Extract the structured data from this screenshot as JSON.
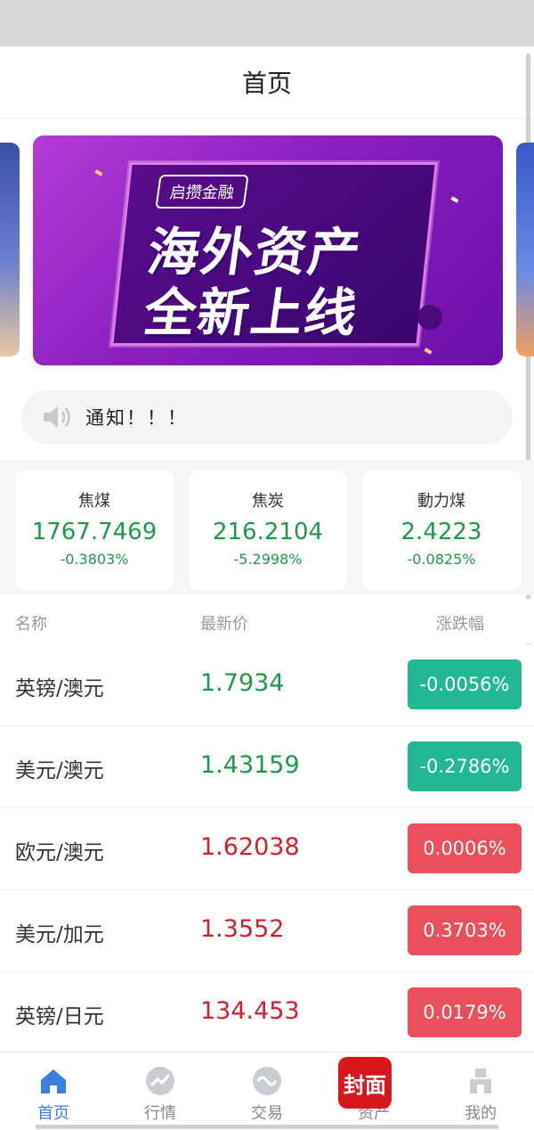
{
  "header": {
    "title": "首页"
  },
  "banner": {
    "brand": "启攒金融",
    "line1": "海外资产",
    "line2": "全新上线"
  },
  "notice": {
    "text": "通知！！！"
  },
  "cards": [
    {
      "name": "焦煤",
      "price": "1767.7469",
      "change": "-0.3803%"
    },
    {
      "name": "焦炭",
      "price": "216.2104",
      "change": "-5.2998%"
    },
    {
      "name": "動力煤",
      "price": "2.4223",
      "change": "-0.0825%"
    }
  ],
  "list": {
    "headers": {
      "name": "名称",
      "price": "最新价",
      "change": "涨跌幅"
    },
    "rows": [
      {
        "pair": "英镑/澳元",
        "price": "1.7934",
        "change": "-0.0056%",
        "direction": "down"
      },
      {
        "pair": "美元/澳元",
        "price": "1.43159",
        "change": "-0.2786%",
        "direction": "down"
      },
      {
        "pair": "欧元/澳元",
        "price": "1.62038",
        "change": "0.0006%",
        "direction": "up"
      },
      {
        "pair": "美元/加元",
        "price": "1.3552",
        "change": "0.3703%",
        "direction": "up"
      },
      {
        "pair": "英镑/日元",
        "price": "134.453",
        "change": "0.0179%",
        "direction": "up"
      }
    ]
  },
  "tabs": [
    {
      "label": "首页",
      "icon": "home-icon",
      "active": true
    },
    {
      "label": "行情",
      "icon": "chart-icon",
      "active": false
    },
    {
      "label": "交易",
      "icon": "exchange-icon",
      "active": false
    },
    {
      "label": "资产",
      "icon": "wallet-icon",
      "active": false
    },
    {
      "label": "我的",
      "icon": "profile-icon",
      "active": false
    }
  ],
  "watermark": {
    "text": "封面"
  },
  "colors": {
    "up": "#d0202e",
    "down": "#1f9a4a",
    "up_badge": "#ea4f5c",
    "down_badge": "#22b795",
    "active_tab": "#3a7ee0"
  }
}
